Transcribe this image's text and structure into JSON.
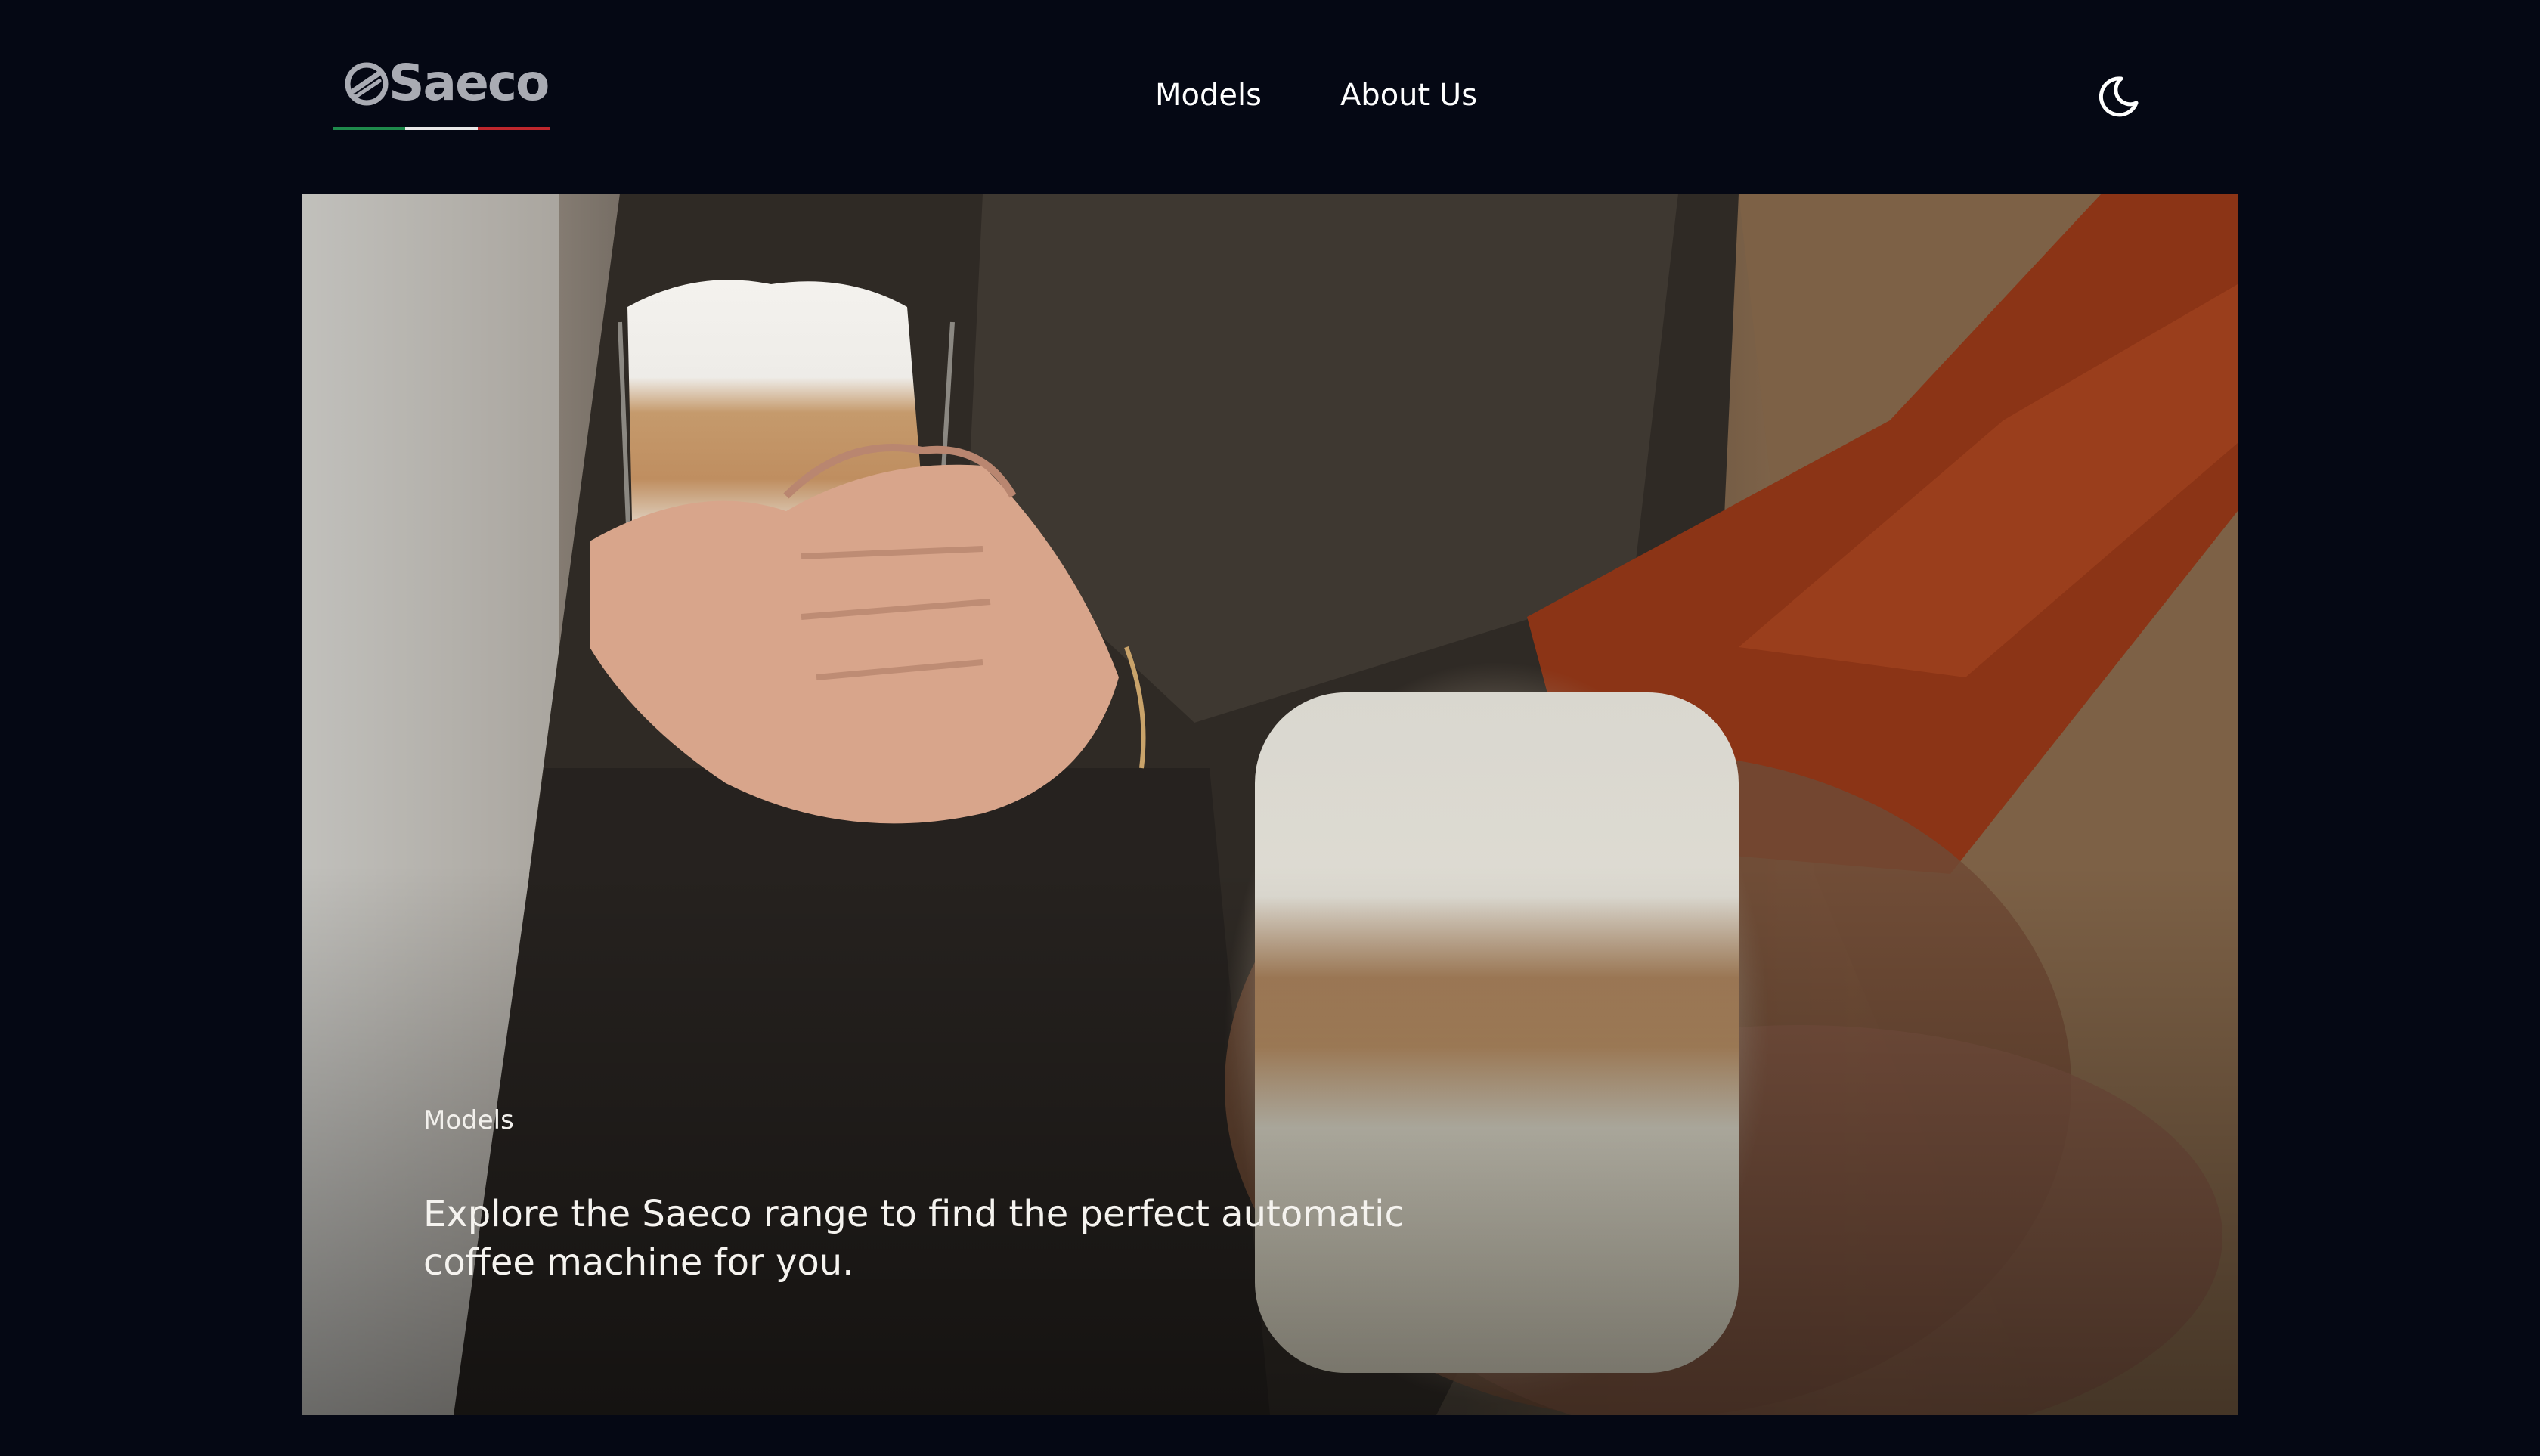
{
  "brand": {
    "logo_text": "Saeco",
    "stripe_colors": [
      "#1f8a4c",
      "#e8e8e8",
      "#c0272d"
    ],
    "logo_color": "#a9abb3"
  },
  "nav": {
    "items": [
      {
        "label": "Models"
      },
      {
        "label": "About Us"
      }
    ]
  },
  "theme_toggle": {
    "icon": "moon-icon"
  },
  "hero": {
    "eyebrow": "Models",
    "text": "Explore the Saeco range to find the perfect automatic coffee machine for you."
  },
  "colors": {
    "page_background": "#050814",
    "text": "#ffffff"
  }
}
